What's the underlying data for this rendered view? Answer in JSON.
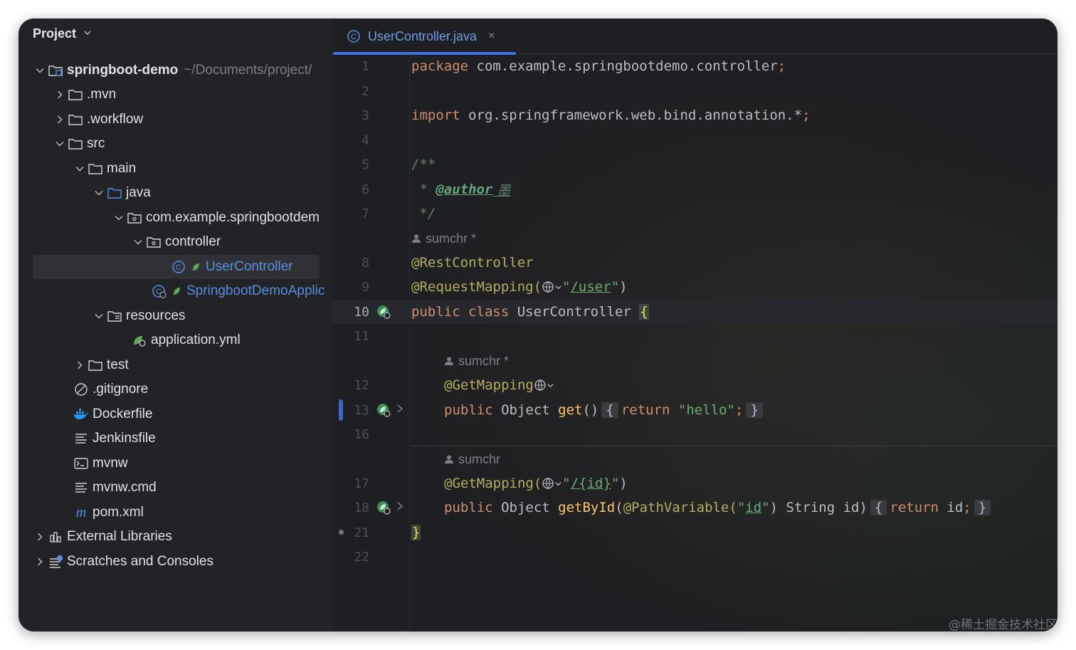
{
  "project_panel": {
    "title": "Project",
    "tree": [
      {
        "label": "springboot-demo",
        "path_hint": "~/Documents/project/"
      },
      {
        "label": ".mvn"
      },
      {
        "label": ".workflow"
      },
      {
        "label": "src"
      },
      {
        "label": "main"
      },
      {
        "label": "java"
      },
      {
        "label": "com.example.springbootdem"
      },
      {
        "label": "controller"
      },
      {
        "label": "UserController"
      },
      {
        "label": "SpringbootDemoApplic"
      },
      {
        "label": "resources"
      },
      {
        "label": "application.yml"
      },
      {
        "label": "test"
      },
      {
        "label": ".gitignore"
      },
      {
        "label": "Dockerfile"
      },
      {
        "label": "Jenkinsfile"
      },
      {
        "label": "mvnw"
      },
      {
        "label": "mvnw.cmd"
      },
      {
        "label": "pom.xml"
      },
      {
        "label": "External Libraries"
      },
      {
        "label": "Scratches and Consoles"
      }
    ]
  },
  "editor": {
    "tab": {
      "label": "UserController.java",
      "close": "×"
    },
    "line_numbers": [
      "1",
      "2",
      "3",
      "4",
      "5",
      "6",
      "7",
      "8",
      "9",
      "10",
      "11",
      "12",
      "13",
      "16",
      "17",
      "18",
      "21",
      "22"
    ],
    "code": {
      "l1_kw": "package",
      "l1_rest": " com.example.springbootdemo.controller",
      "semi": ";",
      "l3_kw": "import",
      "l3_rest": " org.springframework.web.bind.annotation.*",
      "l5": "/**",
      "l6_star": " * ",
      "l6_tag": "@author",
      "l6_name": " 墨",
      "l7": " */",
      "author1": "sumchr *",
      "l8": "@RestController",
      "l9_ann": "@RequestMapping(",
      "l9_q1": "\"",
      "l9_path": "/user",
      "l9_q2": "\"",
      "l9_close": ")",
      "l10_kw": "public class",
      "l10_name": " UserController ",
      "l10_brace": "{",
      "author2": "sumchr *",
      "l12": "@GetMapping",
      "l13_kw": "public",
      "l13_type": " Object ",
      "l13_method": "get",
      "l13_paren": "()",
      "l13_open": "{",
      "l13_ret": "return",
      "l13_str": " \"hello\"",
      "l13_close": "}",
      "author3": "sumchr",
      "l17_ann": "@GetMapping(",
      "l17_path": "/{id}",
      "l17_close": ")",
      "l18_kw": "public",
      "l18_type": " Object ",
      "l18_method": "getById",
      "l18_paren": "(",
      "l18_ann": "@PathVariable(",
      "l18_q1": "\"",
      "l18_id": "id",
      "l18_q2": "\"",
      "l18_rest": ") String id)",
      "l18_open": "{",
      "l18_ret": "return",
      "l18_ret_val": " id",
      "l18_close": "}",
      "l21": "}"
    }
  },
  "watermark": "@稀土掘金技术社区",
  "colors": {
    "keyword": "#cf8e6d",
    "annotation": "#b3ae60",
    "string": "#6aab73",
    "comment": "#5f826b",
    "method": "#ffc66d",
    "accent": "#3b74e0"
  }
}
